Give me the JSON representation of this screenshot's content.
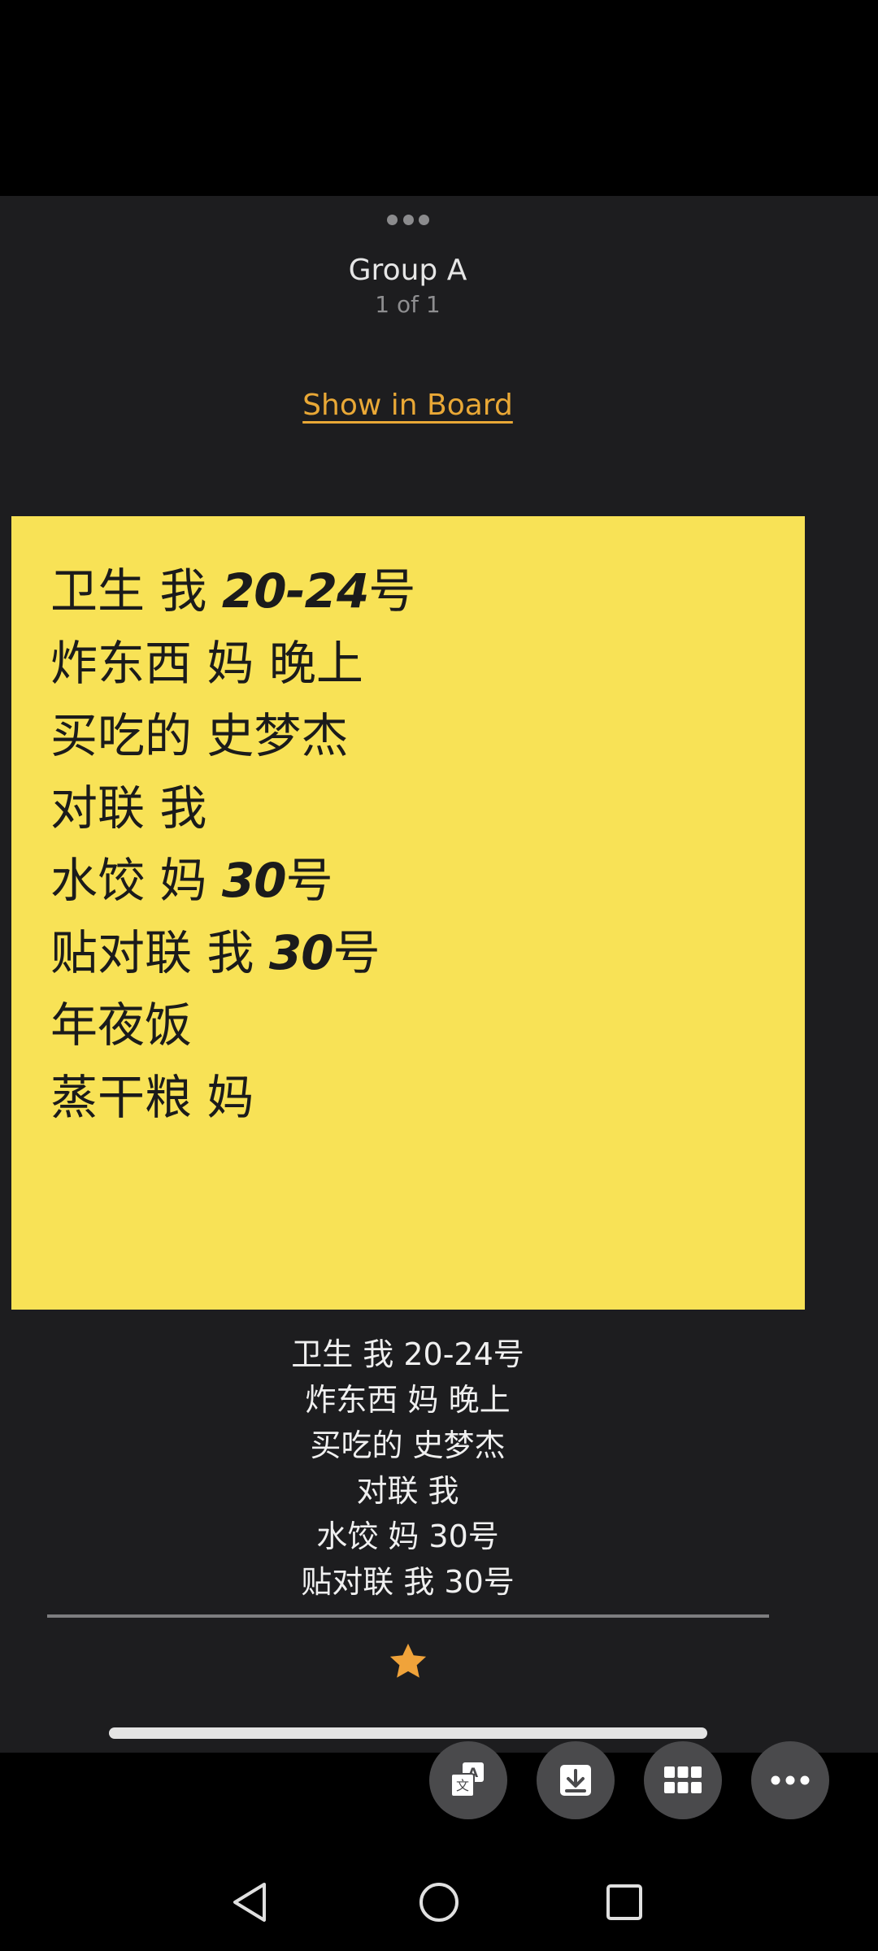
{
  "sheet": {
    "title": "Group A",
    "count": "1 of 1",
    "board_link": "Show in Board"
  },
  "note": {
    "color": "#f8e256",
    "lines": [
      {
        "text": "卫生 我 ",
        "number": "20-24",
        "suffix": "号"
      },
      {
        "text": "炸东西 妈 晚上",
        "number": "",
        "suffix": ""
      },
      {
        "text": "买吃的 史梦杰",
        "number": "",
        "suffix": ""
      },
      {
        "text": "对联 我",
        "number": "",
        "suffix": ""
      },
      {
        "text": "水饺 妈 ",
        "number": "30",
        "suffix": "号"
      },
      {
        "text": "贴对联 我 ",
        "number": "30",
        "suffix": "号"
      },
      {
        "text": "年夜饭",
        "number": "",
        "suffix": ""
      },
      {
        "text": "蒸干粮 妈",
        "number": "",
        "suffix": ""
      }
    ]
  },
  "caption": {
    "lines": [
      "卫生 我 20-24号",
      "炸东西 妈 晚上",
      "买吃的 史梦杰",
      "对联 我",
      "水饺 妈 30号",
      "贴对联 我 30号"
    ]
  },
  "favorite": {
    "icon": "star-icon",
    "color": "#f0a33a"
  },
  "actions": [
    {
      "icon": "translate-icon"
    },
    {
      "icon": "download-icon"
    },
    {
      "icon": "grid-icon"
    },
    {
      "icon": "more-icon"
    }
  ],
  "nav": [
    {
      "icon": "back-icon"
    },
    {
      "icon": "home-icon"
    },
    {
      "icon": "recents-icon"
    }
  ]
}
